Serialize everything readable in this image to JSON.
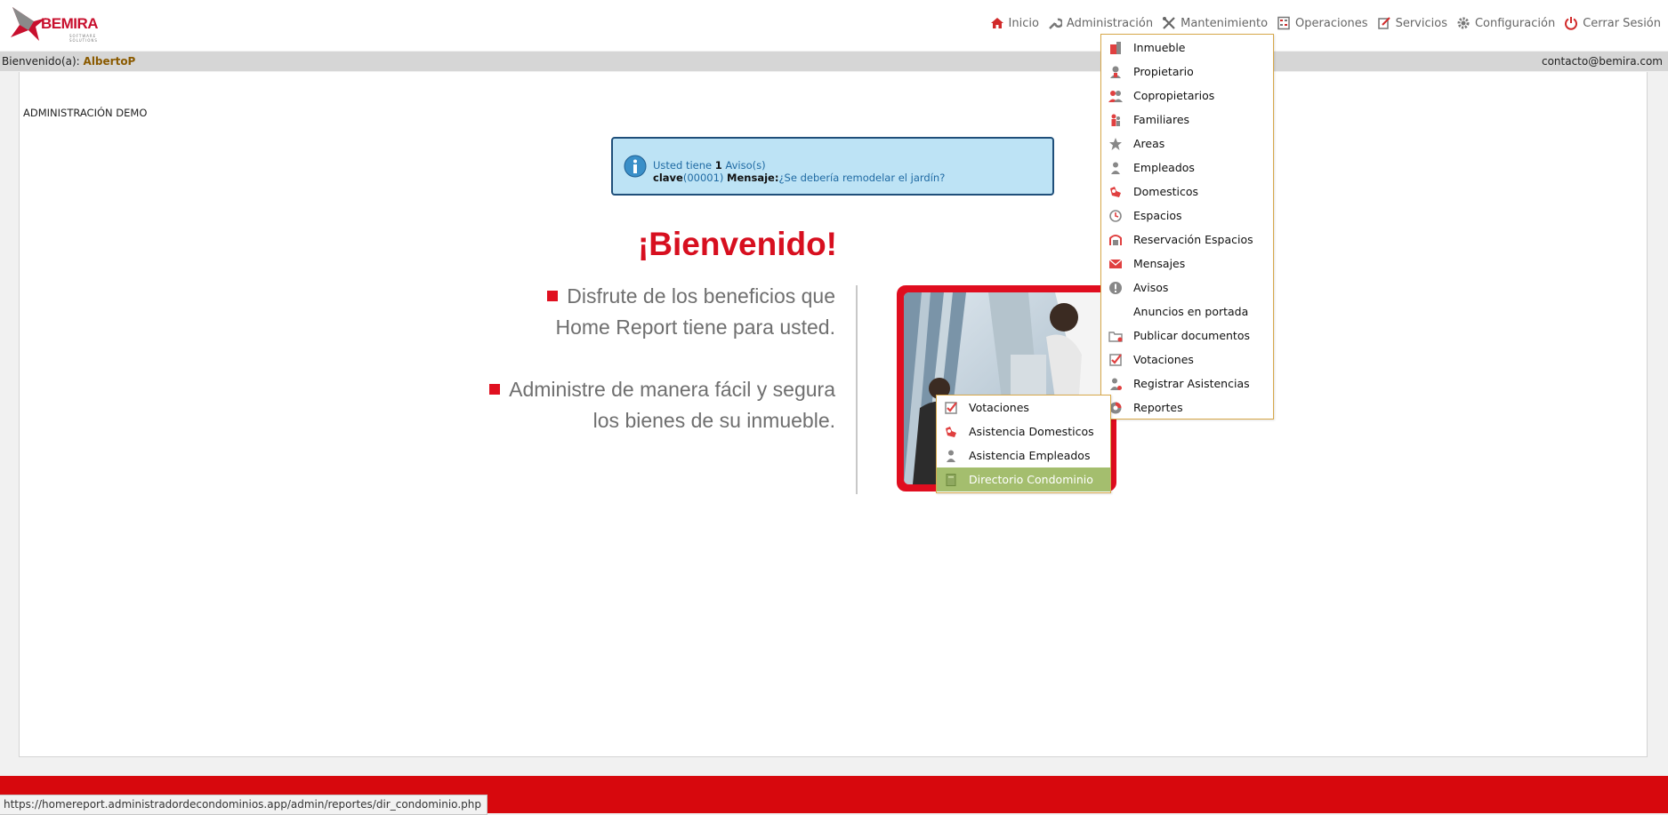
{
  "header": {
    "logo_text": "BEMIRA",
    "logo_tagline": "SOFTWARE SOLUTIONS",
    "nav": [
      {
        "label": "Inicio",
        "icon": "home-icon"
      },
      {
        "label": "Administración",
        "icon": "wrench-icon"
      },
      {
        "label": "Mantenimiento",
        "icon": "tools-icon"
      },
      {
        "label": "Operaciones",
        "icon": "calculator-icon"
      },
      {
        "label": "Servicios",
        "icon": "edit-icon"
      },
      {
        "label": "Configuración",
        "icon": "gear-icon"
      },
      {
        "label": "Cerrar Sesión",
        "icon": "power-icon"
      }
    ]
  },
  "welcome_bar": {
    "prefix": "Bienvenido(a):",
    "username": "AlbertoP",
    "email": "contacto@bemira.com"
  },
  "main": {
    "org_name": "ADMINISTRACIÓN DEMO",
    "notice": {
      "prefix": "Usted tiene",
      "count": "1",
      "suffix": "Aviso(s)",
      "key_label": "clave",
      "key_value": "(00001)",
      "message_label": "Mensaje:",
      "message_link": "¿Se debería remodelar el jardín?"
    },
    "welcome_title": "¡Bienvenido!",
    "benefit1_line1": "Disfrute de los beneficios que",
    "benefit1_line2": "Home Report tiene para usted.",
    "benefit2_line1": "Administre de manera fácil y segura",
    "benefit2_line2": "los bienes de su inmueble."
  },
  "admin_menu": {
    "items": [
      {
        "label": "Inmueble",
        "icon": "building-icon"
      },
      {
        "label": "Propietario",
        "icon": "owner-icon"
      },
      {
        "label": "Copropietarios",
        "icon": "co-owners-icon"
      },
      {
        "label": "Familiares",
        "icon": "family-icon"
      },
      {
        "label": "Areas",
        "icon": "star-icon"
      },
      {
        "label": "Empleados",
        "icon": "employee-icon"
      },
      {
        "label": "Domesticos",
        "icon": "domestic-icon"
      },
      {
        "label": "Espacios",
        "icon": "clock-icon"
      },
      {
        "label": "Reservación Espacios",
        "icon": "reservation-icon"
      },
      {
        "label": "Mensajes",
        "icon": "mail-icon"
      },
      {
        "label": "Avisos",
        "icon": "alert-icon"
      },
      {
        "label": "Anuncios en portada",
        "icon": ""
      },
      {
        "label": "Publicar documentos",
        "icon": "folder-icon"
      },
      {
        "label": "Votaciones",
        "icon": "checkbox-icon"
      },
      {
        "label": "Registrar Asistencias",
        "icon": "attendance-icon"
      },
      {
        "label": "Reportes",
        "icon": "pie-chart-icon"
      }
    ]
  },
  "reports_submenu": {
    "items": [
      {
        "label": "Votaciones",
        "icon": "checkbox-icon"
      },
      {
        "label": "Asistencia Domesticos",
        "icon": "domestic-icon"
      },
      {
        "label": "Asistencia Empleados",
        "icon": "employee-icon"
      },
      {
        "label": "Directorio Condominio",
        "icon": "directory-icon"
      }
    ],
    "active_label": "Directorio Condominio"
  },
  "footer": {
    "status_url": "https://homereport.administradordecondominios.app/admin/reportes/dir_condominio.php"
  },
  "colors": {
    "brand_red": "#d70f1f",
    "menu_border": "#d7a84a",
    "active_item": "#a4be6e",
    "notice_bg": "#bde3f5"
  }
}
